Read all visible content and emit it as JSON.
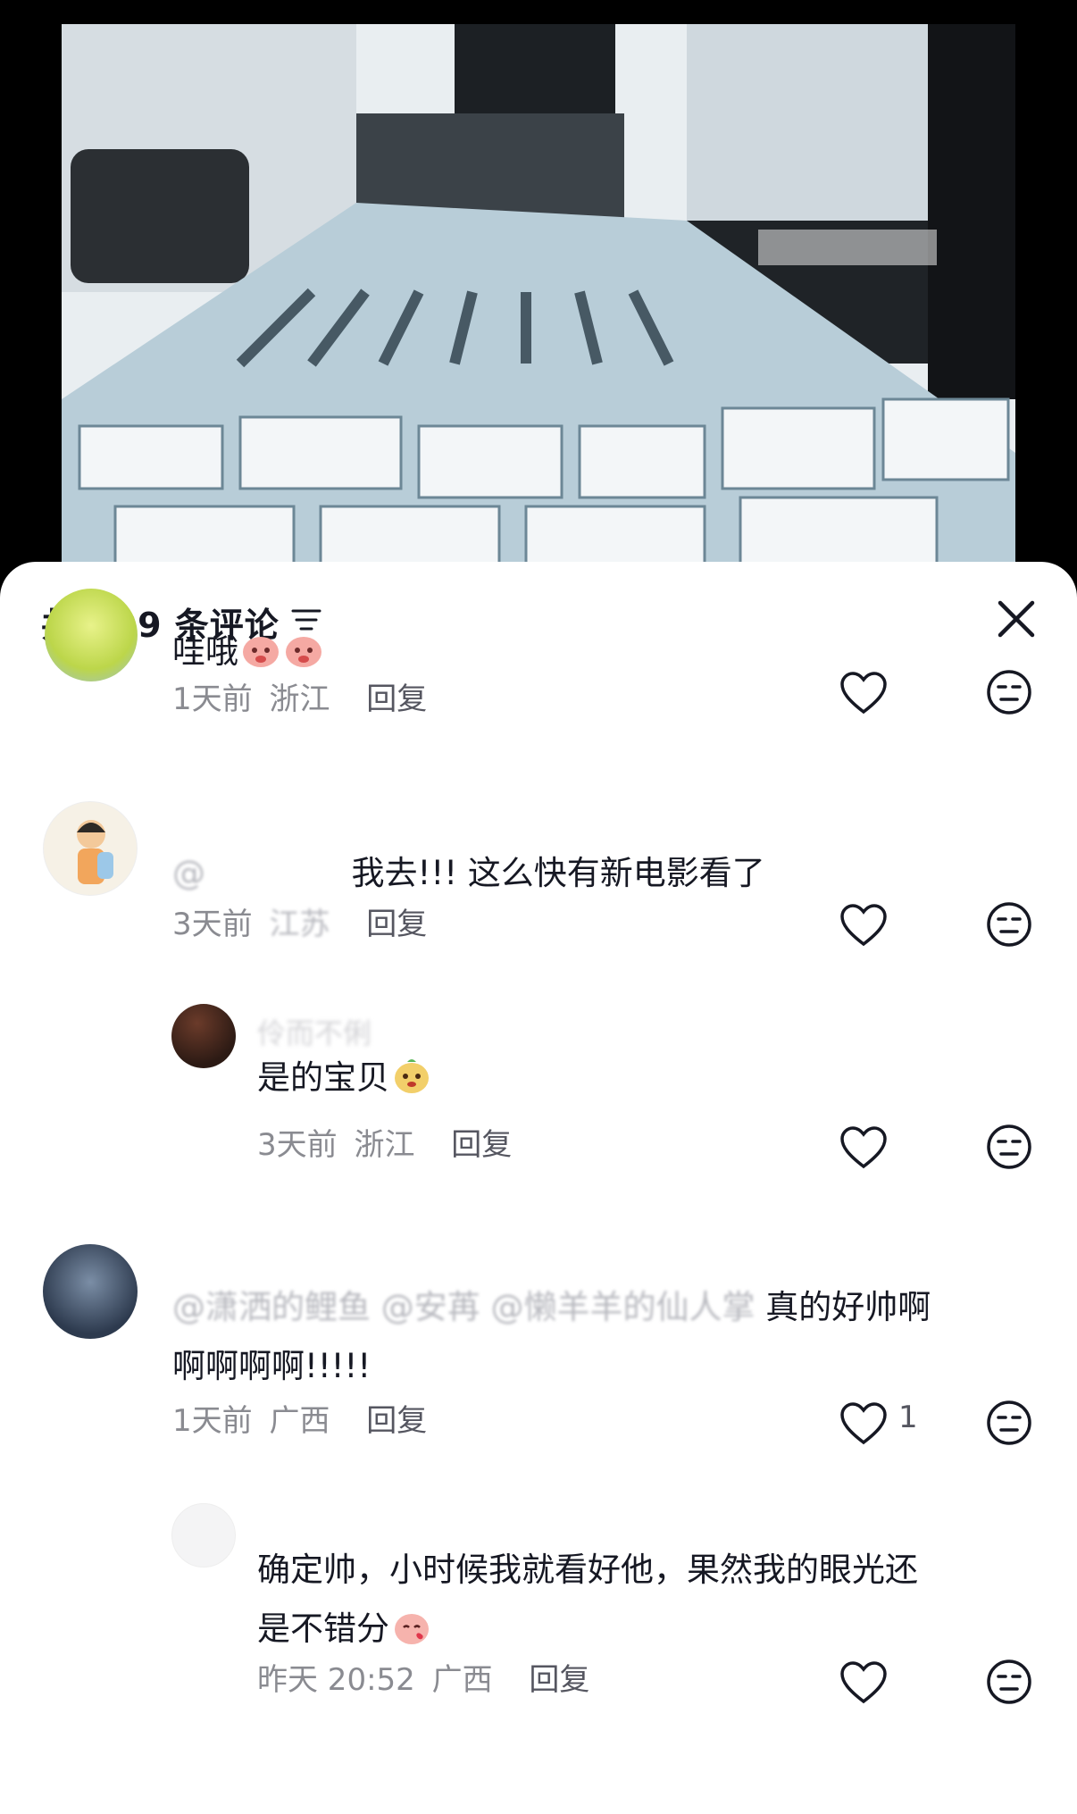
{
  "sheet": {
    "title": "共 809 条评论"
  },
  "comments": [
    {
      "text": "哇哦",
      "emojis": [
        "peach-emoji",
        "peach-emoji"
      ],
      "time": "1天前",
      "location": "浙江",
      "reply": "回复"
    },
    {
      "mention": "@",
      "text": "我去!!!  这么快有新电影看了",
      "time": "3天前",
      "location": "江苏",
      "reply": "回复"
    },
    {
      "username": "伶而不俐",
      "text": "是的宝贝",
      "emojis": [
        "potato-emoji"
      ],
      "time": "3天前",
      "location": "浙江",
      "reply": "回复"
    },
    {
      "mention": "@潇洒的鲤鱼 @安苒 @懒羊羊的仙人掌",
      "text_line1": "真的好帅啊",
      "text_line2": "啊啊啊啊!!!!!",
      "time": "1天前",
      "location": "广西",
      "reply": "回复",
      "likes": "1"
    },
    {
      "text_line1": "确定帅，小时候我就看好他，果然我的眼光还",
      "text_line2": "是不错分",
      "emojis": [
        "peach-kiss-emoji"
      ],
      "time": "昨天 20:52",
      "location": "广西",
      "reply": "回复"
    }
  ]
}
